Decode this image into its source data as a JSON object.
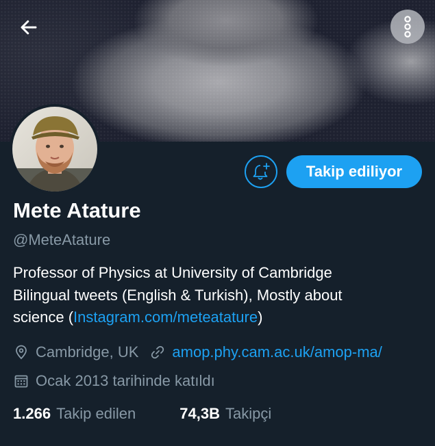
{
  "header": {
    "back_icon": "arrow-left-icon",
    "more_icon": "more-vertical-icon"
  },
  "profile": {
    "name": "Mete Atature",
    "handle": "@MeteAtature",
    "bio_line1": "Professor of Physics at University of Cambridge",
    "bio_line2": "Bilingual tweets (English & Turkish), Mostly about",
    "bio_prefix": "science (",
    "bio_link": "Instagram.com/meteatature",
    "bio_suffix": ")",
    "location": "Cambridge, UK",
    "website": "amop.phy.cam.ac.uk/amop-ma/",
    "joined": "Ocak 2013 tarihinde katıldı"
  },
  "actions": {
    "notify_icon": "bell-plus-icon",
    "follow_label": "Takip ediliyor"
  },
  "stats": {
    "following_count": "1.266",
    "following_label": "Takip edilen",
    "followers_count": "74,3B",
    "followers_label": "Takipçi"
  },
  "colors": {
    "background": "#15202b",
    "accent": "#1da1f2",
    "secondary_text": "#8899a6"
  }
}
